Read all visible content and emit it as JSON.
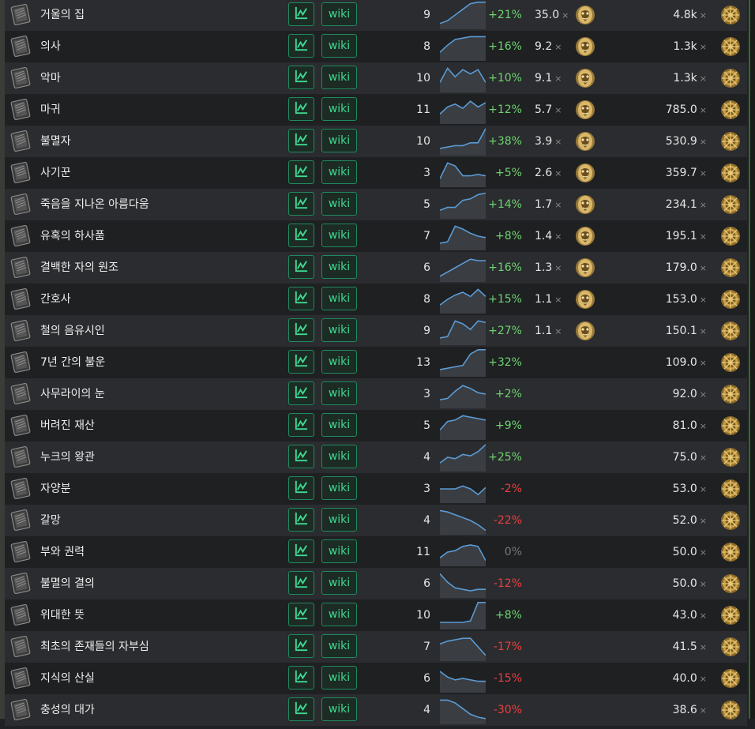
{
  "buttons": {
    "wiki_label": "wiki",
    "x_symbol": "×"
  },
  "icons": {
    "card": "divination-card-icon",
    "chart": "chart-icon",
    "divine": "divine-orb-icon",
    "chaos": "chaos-orb-icon"
  },
  "colors": {
    "positive": "#6fd36f",
    "negative": "#e84040",
    "neutral": "#777777",
    "accent": "#3ed98f"
  },
  "rows": [
    {
      "name": "거울의 집",
      "count": "9",
      "change": "+21%",
      "trend": "up",
      "spark": [
        0.2,
        0.3,
        0.5,
        0.7,
        0.9,
        0.95,
        0.95
      ],
      "divine": "35.0",
      "chaos": "4.8k"
    },
    {
      "name": "의사",
      "count": "8",
      "change": "+16%",
      "trend": "up",
      "spark": [
        0.3,
        0.55,
        0.75,
        0.8,
        0.85,
        0.85,
        0.85
      ],
      "divine": "9.2",
      "chaos": "1.3k"
    },
    {
      "name": "악마",
      "count": "10",
      "change": "+10%",
      "trend": "up",
      "spark": [
        0.35,
        0.85,
        0.55,
        0.8,
        0.65,
        0.8,
        0.35
      ],
      "divine": "9.1",
      "chaos": "1.3k"
    },
    {
      "name": "마귀",
      "count": "11",
      "change": "+12%",
      "trend": "up",
      "spark": [
        0.35,
        0.6,
        0.7,
        0.55,
        0.8,
        0.6,
        0.75
      ],
      "divine": "5.7",
      "chaos": "785.0"
    },
    {
      "name": "불멸자",
      "count": "10",
      "change": "+38%",
      "trend": "up",
      "spark": [
        0.25,
        0.3,
        0.35,
        0.35,
        0.45,
        0.45,
        0.95
      ],
      "divine": "3.9",
      "chaos": "530.9"
    },
    {
      "name": "사기꾼",
      "count": "3",
      "change": "+5%",
      "trend": "up",
      "spark": [
        0.3,
        0.85,
        0.75,
        0.4,
        0.4,
        0.45,
        0.4
      ],
      "divine": "2.6",
      "chaos": "359.7"
    },
    {
      "name": "죽음을 지나온 아름다움",
      "count": "5",
      "change": "+14%",
      "trend": "up",
      "spark": [
        0.3,
        0.4,
        0.4,
        0.65,
        0.7,
        0.85,
        0.9
      ],
      "divine": "1.7",
      "chaos": "234.1"
    },
    {
      "name": "유혹의 하사품",
      "count": "7",
      "change": "+8%",
      "trend": "up",
      "spark": [
        0.25,
        0.3,
        0.85,
        0.75,
        0.6,
        0.5,
        0.45
      ],
      "divine": "1.4",
      "chaos": "195.1"
    },
    {
      "name": "결백한 자의 원조",
      "count": "6",
      "change": "+16%",
      "trend": "up",
      "spark": [
        0.2,
        0.35,
        0.5,
        0.65,
        0.8,
        0.75,
        0.75
      ],
      "divine": "1.3",
      "chaos": "179.0"
    },
    {
      "name": "간호사",
      "count": "8",
      "change": "+15%",
      "trend": "up",
      "spark": [
        0.3,
        0.5,
        0.65,
        0.75,
        0.6,
        0.85,
        0.6
      ],
      "divine": "1.1",
      "chaos": "153.0"
    },
    {
      "name": "철의 음유시인",
      "count": "9",
      "change": "+27%",
      "trend": "up",
      "spark": [
        0.25,
        0.3,
        0.85,
        0.75,
        0.55,
        0.85,
        0.8
      ],
      "divine": "1.1",
      "chaos": "150.1"
    },
    {
      "name": "7년 간의 불운",
      "count": "13",
      "change": "+32%",
      "trend": "up",
      "spark": [
        0.25,
        0.3,
        0.35,
        0.4,
        0.8,
        0.95,
        0.95
      ],
      "divine": "",
      "chaos": "109.0"
    },
    {
      "name": "사무라이의 눈",
      "count": "3",
      "change": "+2%",
      "trend": "up",
      "spark": [
        0.3,
        0.35,
        0.6,
        0.8,
        0.7,
        0.55,
        0.5
      ],
      "divine": "",
      "chaos": "92.0"
    },
    {
      "name": "버려진 재산",
      "count": "5",
      "change": "+9%",
      "trend": "up",
      "spark": [
        0.35,
        0.65,
        0.7,
        0.85,
        0.8,
        0.75,
        0.7
      ],
      "divine": "",
      "chaos": "81.0"
    },
    {
      "name": "누크의 왕관",
      "count": "4",
      "change": "+25%",
      "trend": "up",
      "spark": [
        0.3,
        0.5,
        0.45,
        0.6,
        0.55,
        0.7,
        0.95
      ],
      "divine": "",
      "chaos": "75.0"
    },
    {
      "name": "자양분",
      "count": "3",
      "change": "-2%",
      "trend": "down",
      "spark": [
        0.5,
        0.5,
        0.5,
        0.6,
        0.5,
        0.3,
        0.55
      ],
      "divine": "",
      "chaos": "53.0"
    },
    {
      "name": "갈망",
      "count": "4",
      "change": "-22%",
      "trend": "down",
      "spark": [
        0.85,
        0.8,
        0.7,
        0.6,
        0.5,
        0.35,
        0.15
      ],
      "divine": "",
      "chaos": "52.0"
    },
    {
      "name": "부와 권력",
      "count": "11",
      "change": "0%",
      "trend": "flat",
      "spark": [
        0.3,
        0.5,
        0.55,
        0.7,
        0.75,
        0.7,
        0.2
      ],
      "divine": "",
      "chaos": "50.0"
    },
    {
      "name": "불멸의 결의",
      "count": "6",
      "change": "-12%",
      "trend": "down",
      "spark": [
        0.85,
        0.55,
        0.35,
        0.3,
        0.25,
        0.3,
        0.3
      ],
      "divine": "",
      "chaos": "50.0"
    },
    {
      "name": "위대한 뜻",
      "count": "10",
      "change": "+8%",
      "trend": "up",
      "spark": [
        0.25,
        0.25,
        0.25,
        0.25,
        0.3,
        0.95,
        0.95
      ],
      "divine": "",
      "chaos": "43.0"
    },
    {
      "name": "최초의 존재들의 자부심",
      "count": "7",
      "change": "-17%",
      "trend": "down",
      "spark": [
        0.6,
        0.7,
        0.75,
        0.8,
        0.8,
        0.5,
        0.2
      ],
      "divine": "",
      "chaos": "41.5"
    },
    {
      "name": "지식의 산실",
      "count": "6",
      "change": "-15%",
      "trend": "down",
      "spark": [
        0.75,
        0.55,
        0.45,
        0.5,
        0.45,
        0.4,
        0.4
      ],
      "divine": "",
      "chaos": "40.0"
    },
    {
      "name": "충성의 대가",
      "count": "4",
      "change": "-30%",
      "trend": "down",
      "spark": [
        0.85,
        0.85,
        0.75,
        0.55,
        0.35,
        0.25,
        0.2
      ],
      "divine": "",
      "chaos": "38.6"
    }
  ]
}
